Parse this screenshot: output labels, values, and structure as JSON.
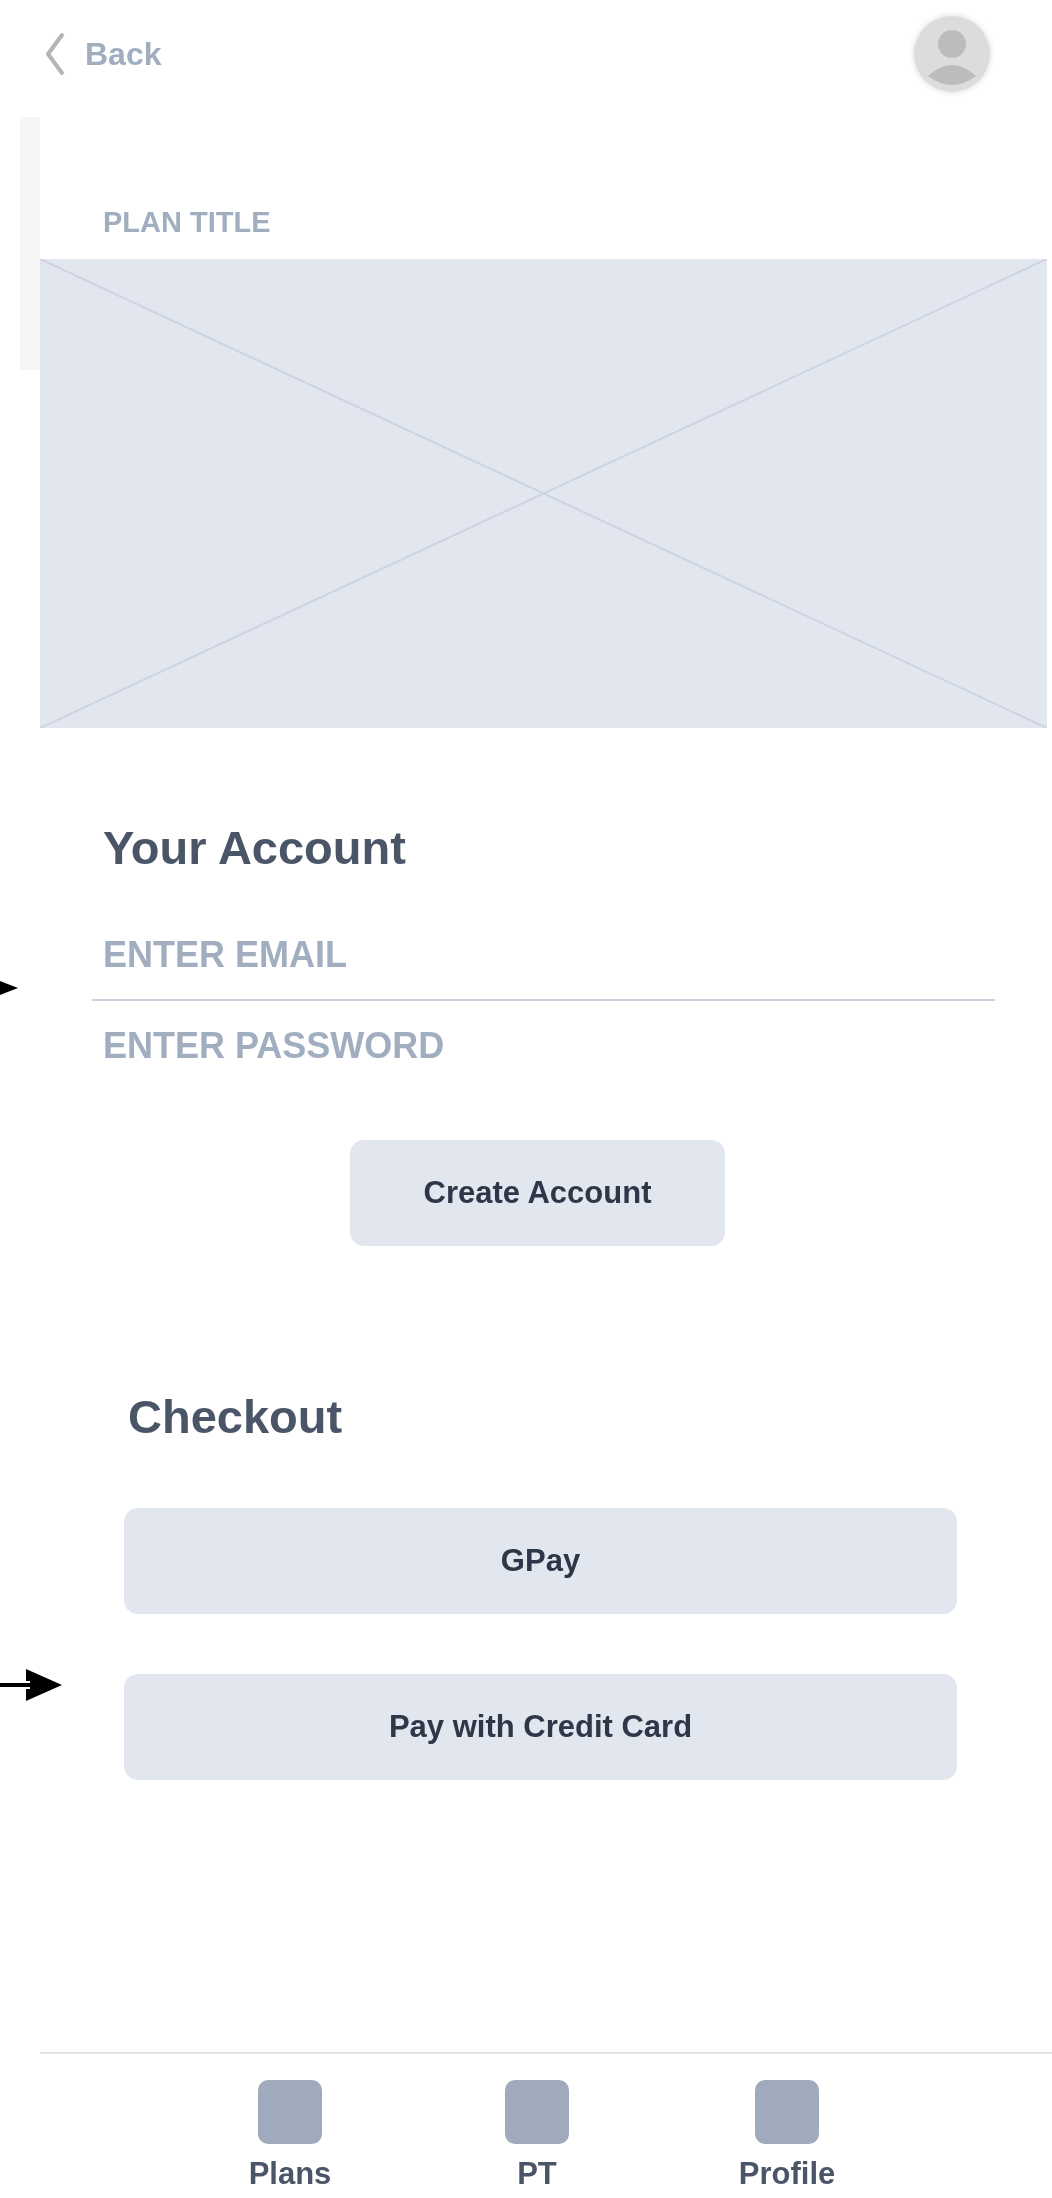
{
  "header": {
    "back_label": "Back"
  },
  "plan": {
    "title": "PLAN TITLE"
  },
  "account": {
    "title": "Your Account",
    "email": {
      "placeholder": "ENTER EMAIL"
    },
    "password": {
      "placeholder": "ENTER PASSWORD"
    },
    "button": "Create Account"
  },
  "checkout": {
    "title": "Checkout",
    "buttons": [
      "GPay",
      "Pay with Credit Card"
    ]
  },
  "nav": [
    {
      "label": "Plans"
    },
    {
      "label": "PT"
    },
    {
      "label": "Profile"
    }
  ]
}
